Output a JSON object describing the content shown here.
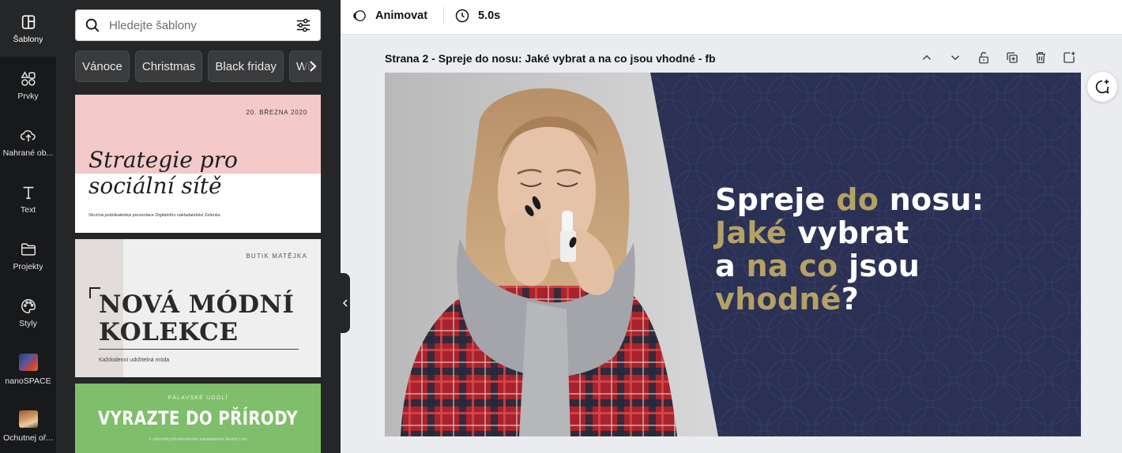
{
  "rail": {
    "items": [
      {
        "label": "Šablony",
        "icon": "templates-icon"
      },
      {
        "label": "Prvky",
        "icon": "elements-icon"
      },
      {
        "label": "Nahrané ob...",
        "icon": "upload-cloud-icon"
      },
      {
        "label": "Text",
        "icon": "text-icon"
      },
      {
        "label": "Projekty",
        "icon": "folder-icon"
      },
      {
        "label": "Styly",
        "icon": "palette-icon"
      },
      {
        "label": "nanoSPACE",
        "icon": "app-thumbnail"
      },
      {
        "label": "Ochutnej oř...",
        "icon": "app-thumbnail"
      }
    ]
  },
  "panel": {
    "search_placeholder": "Hledejte šablony",
    "chips": [
      "Vánoce",
      "Christmas",
      "Black friday",
      "Win"
    ],
    "templates": [
      {
        "date": "20. BŘEZNA 2020",
        "title_line1": "Strategie pro",
        "title_line2": "sociální sítě",
        "subtitle": "Stručná podnikatelská prezentace Digitálního nakladatelství Zelenka"
      },
      {
        "brand": "BUTIK MATĚJKA",
        "title_line1": "NOVÁ MÓDNÍ",
        "title_line2": "KOLEKCE",
        "subtitle": "Každodenní udržitelná móda"
      },
      {
        "top": "PÁLAVSKÉ ÚDOLÍ",
        "title": "VYRAZTE DO PŘÍRODY",
        "subtitle": "S odborníky přírodovědného nakladatelství Stručný Lom"
      }
    ]
  },
  "topbar": {
    "animate_label": "Animovat",
    "duration_label": "5.0s"
  },
  "page": {
    "title": "Strana 2 - Spreje do nosu: Jaké vybrat a na co jsou vhodné - fb",
    "headline": {
      "l1a": "Spreje ",
      "l1b": "do",
      "l1c": " nosu:",
      "l2a": "Jaké",
      "l2b": " vybrat",
      "l3a": "a ",
      "l3b": "na co",
      "l3c": " jsou ",
      "l3d": "vhodné",
      "l3e": "?"
    }
  },
  "colors": {
    "rail_bg": "#18191b",
    "panel_bg": "#252627",
    "design_navy": "#2b3154",
    "gold_accent": "#b4a165"
  }
}
